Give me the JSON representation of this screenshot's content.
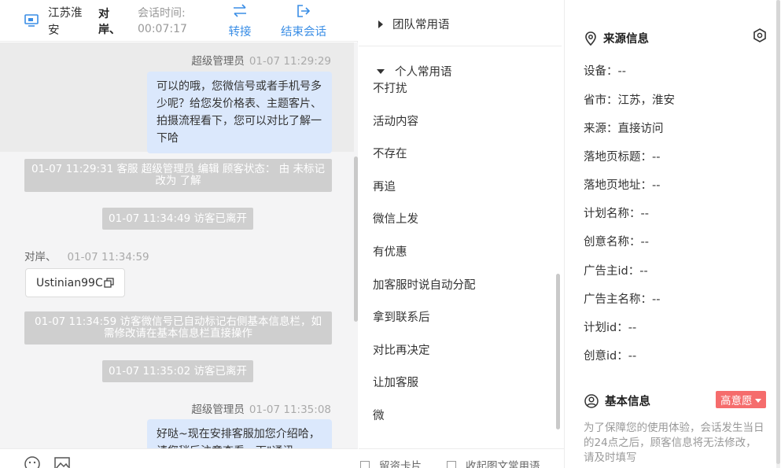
{
  "header": {
    "region": "江苏淮安",
    "visitor_name": "对岸、",
    "session_time_label": "会话时间:",
    "session_time": "00:07:17",
    "transfer_label": "转接",
    "end_label": "结束会话"
  },
  "chat": {
    "messages": [
      {
        "sender": "超级管理员",
        "time": "01-07 11:29:29",
        "text": "可以的哦，您微信号或者手机号多少呢？给您发价格表、主题客片、拍摄流程看下，您可以对比了解一下哈"
      },
      {
        "system": "01-07 11:29:31 客服 超级管理员 编辑 顾客状态： 由 未标记 改为 了解"
      },
      {
        "system": "01-07 11:34:49 访客已离开"
      },
      {
        "sender": "对岸、",
        "time": "01-07 11:34:59",
        "card": "Ustinian99C"
      },
      {
        "system": "01-07 11:34:59 访客微信号已自动标记右侧基本信息栏，如需修改请在基本信息栏直接操作"
      },
      {
        "system": "01-07 11:35:02 访客已离开"
      },
      {
        "sender": "超级管理员",
        "time": "01-07 11:35:08",
        "text": "好哒~现在安排客服加您介绍哈，请您稍后注意查看一下\"通讯"
      }
    ]
  },
  "phrases": {
    "team_label": "团队常用语",
    "personal_label": "个人常用语",
    "items": [
      "不打扰",
      "活动内容",
      "不存在",
      "再追",
      "微信上发",
      "有优惠",
      "加客服时说自动分配",
      "拿到联系后",
      "对比再决定",
      "让加客服",
      "微"
    ],
    "footer_left": "留资卡片",
    "footer_right": "收起图文常用语"
  },
  "source_info": {
    "title": "来源信息",
    "rows": [
      "设备：--",
      "省市：江苏，淮安",
      "来源：直接访问",
      "落地页标题：--",
      "落地页地址：--",
      "计划名称：--",
      "创意名称：--",
      "广告主id：--",
      "广告主名称：--",
      "计划id：--",
      "创意id：--"
    ]
  },
  "basic_info": {
    "title": "基本信息",
    "intent_tag": "高意愿",
    "note": "为了保障您的使用体验，会话发生当日的24点之后，顾客信息将无法修改，请及时填写"
  },
  "colors": {
    "accent": "#3a8ee6",
    "bubble_bg": "#dbe8fc",
    "system_bg": "#cfcfcf",
    "tag_red": "#f56c6c"
  }
}
